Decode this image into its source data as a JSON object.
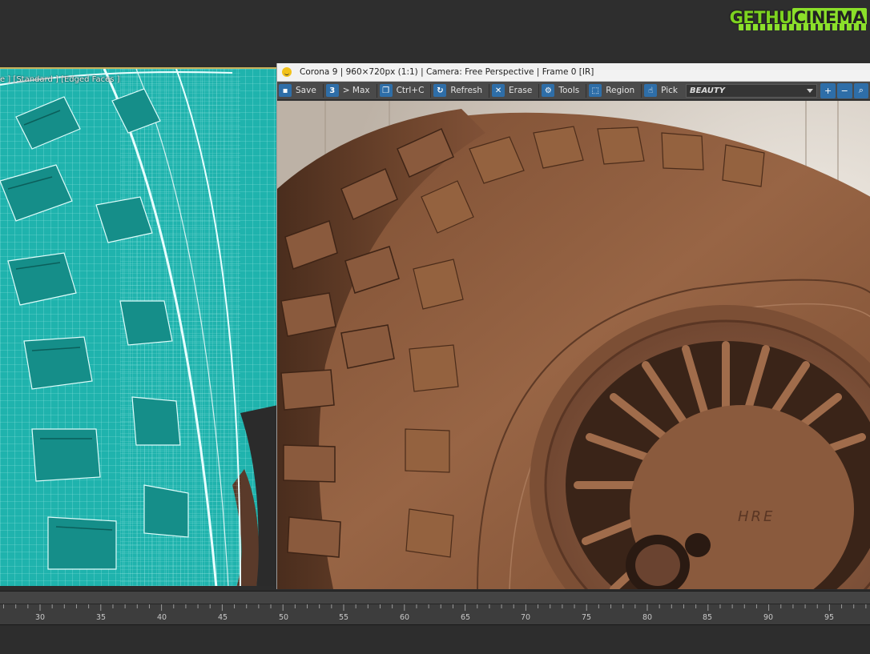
{
  "watermark": {
    "part1": "GETHU",
    "part2": "CINEMA"
  },
  "viewport": {
    "label": "e ] [Standard ] [Edged Faces ]"
  },
  "render_window": {
    "title": "Corona 9 | 960×720px (1:1) | Camera: Free Perspective | Frame 0 [IR]",
    "toolbar": [
      {
        "label": "Save",
        "icon": "save-icon"
      },
      {
        "label": "> Max",
        "icon": "max-icon"
      },
      {
        "label": "Ctrl+C",
        "icon": "copy-icon"
      },
      {
        "label": "Refresh",
        "icon": "refresh-icon"
      },
      {
        "label": "Erase",
        "icon": "erase-icon"
      },
      {
        "label": "Tools",
        "icon": "gear-icon"
      },
      {
        "label": "Region",
        "icon": "region-icon"
      },
      {
        "label": "Pick",
        "icon": "pick-icon"
      }
    ],
    "pass": "BEAUTY",
    "rim_logo": "HRE"
  },
  "timeline": {
    "ticks": [
      "30",
      "35",
      "40",
      "45",
      "50",
      "55",
      "60",
      "65",
      "70",
      "75",
      "80",
      "85",
      "90",
      "95"
    ]
  },
  "colors": {
    "viewport_teal": "#1fb3ad",
    "tire_brown": "#8a5a3c",
    "accent_blue": "#2e6ea8"
  }
}
